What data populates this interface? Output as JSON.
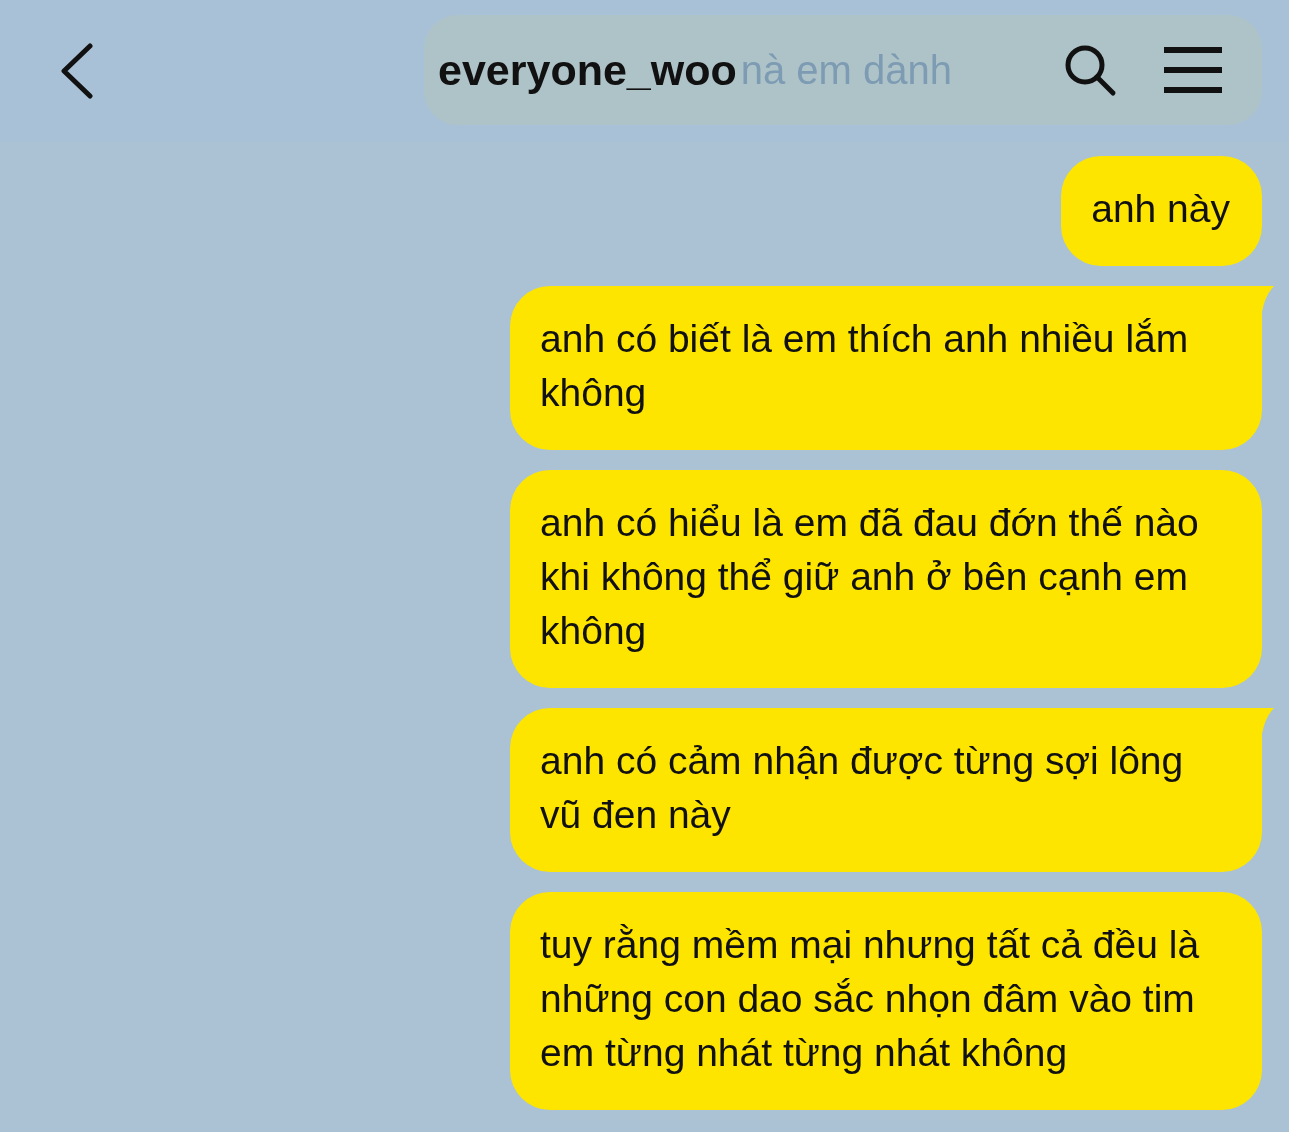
{
  "header": {
    "title": "everyone_woo",
    "pinned_notice": "nà em dành"
  },
  "messages": [
    {
      "text": "anh này",
      "tail": false
    },
    {
      "text": "anh có biết là em thích anh nhiều lắm không",
      "tail": true
    },
    {
      "text": "anh có hiểu là em đã đau đớn thế nào khi không thể giữ anh ở bên cạnh em không",
      "tail": false
    },
    {
      "text": "anh có cảm nhận được từng sợi lông vũ đen này",
      "tail": true
    },
    {
      "text": "tuy rằng mềm mại nhưng tất cả đều là những con dao sắc nhọn đâm vào tim em từng nhát từng nhát không",
      "tail": false
    }
  ]
}
